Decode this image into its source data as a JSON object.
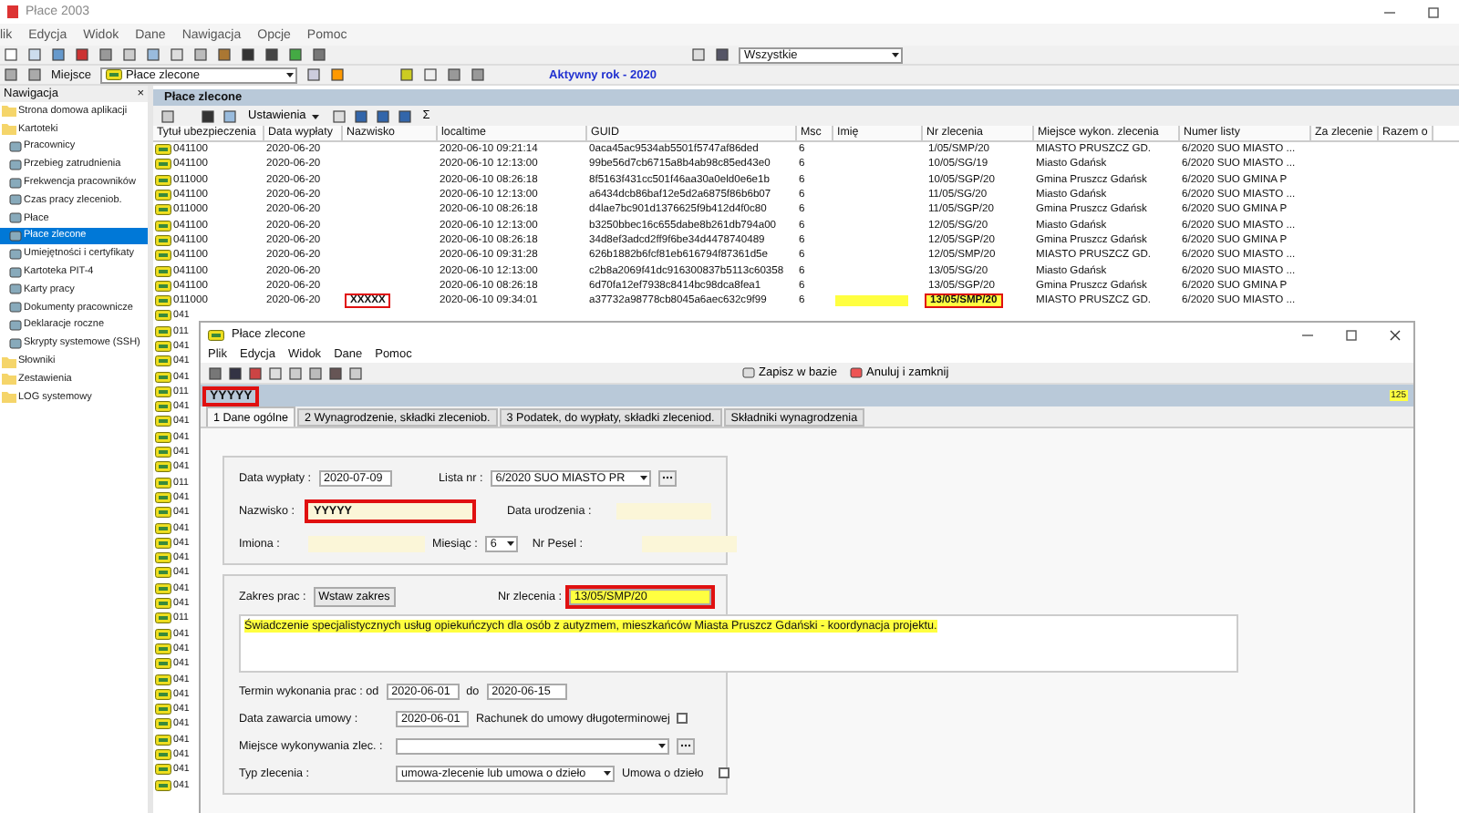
{
  "window": {
    "title": "Płace 2003"
  },
  "menu": [
    "lik",
    "Edycja",
    "Widok",
    "Dane",
    "Nawigacja",
    "Opcje",
    "Pomoc"
  ],
  "toolbar": {
    "filter": "Wszystkie"
  },
  "location_bar": {
    "label": "Miejsce",
    "value": "Płace zlecone",
    "active_year": "Aktywny rok - 2020"
  },
  "navigation": {
    "title": "Nawigacja",
    "close": "×",
    "items": [
      {
        "label": "Strona domowa aplikacji",
        "selected": false
      },
      {
        "label": "Kartoteki",
        "selected": false,
        "children": [
          {
            "label": "Pracownicy",
            "selected": false
          },
          {
            "label": "Przebieg zatrudnienia",
            "selected": false
          },
          {
            "label": "Frekwencja pracowników",
            "selected": false
          },
          {
            "label": "Czas pracy zleceniob.",
            "selected": false
          },
          {
            "label": "Płace",
            "selected": false
          },
          {
            "label": "Płace zlecone",
            "selected": true
          },
          {
            "label": "Umiejętności i certyfikaty",
            "selected": false
          },
          {
            "label": "Kartoteka PIT-4",
            "selected": false
          },
          {
            "label": "Karty pracy",
            "selected": false
          },
          {
            "label": "Dokumenty pracownicze",
            "selected": false
          },
          {
            "label": "Deklaracje roczne",
            "selected": false
          },
          {
            "label": "Skrypty systemowe (SSH)",
            "selected": false
          }
        ]
      },
      {
        "label": "Słowniki",
        "selected": false
      },
      {
        "label": "Zestawienia",
        "selected": false
      },
      {
        "label": "LOG systemowy",
        "selected": false
      }
    ]
  },
  "list": {
    "title": "Płace zlecone",
    "settings": "Ustawienia",
    "sum": "Σ",
    "columns": [
      "Tytuł ubezpieczenia",
      "Data wypłaty",
      "Nazwisko",
      "localtime",
      "GUID",
      "Msc",
      "Imię",
      "Nr zlecenia",
      "Miejsce wykon. zlecenia",
      "Numer listy",
      "Za zlecenie",
      "Razem o"
    ],
    "rows": [
      {
        "tytul": "041100",
        "data": "2020-06-20",
        "localtime": "2020-06-10 09:21:14",
        "guid": "0aca45ac9534ab5501f5747af86ded",
        "msc": "6",
        "nr": "1/05/SMP/20",
        "miejsce": "MIASTO PRUSZCZ GD.",
        "lista": "6/2020 SUO MIASTO ...",
        "annotated": false
      },
      {
        "tytul": "041100",
        "data": "2020-06-20",
        "localtime": "2020-06-10 12:13:00",
        "guid": "99be56d7cb6715a8b4ab98c85ed43e0",
        "msc": "6",
        "nr": "10/05/SG/19",
        "miejsce": "Miasto Gdańsk",
        "lista": "6/2020 SUO MIASTO ...",
        "annotated": false
      },
      {
        "tytul": "011000",
        "data": "2020-06-20",
        "localtime": "2020-06-10 08:26:18",
        "guid": "8f5163f431cc501f46aa30a0eld0e6e1b",
        "msc": "6",
        "nr": "10/05/SGP/20",
        "miejsce": "Gmina Pruszcz Gdańsk",
        "lista": "6/2020 SUO GMINA P",
        "annotated": false
      },
      {
        "tytul": "041100",
        "data": "2020-06-20",
        "localtime": "2020-06-10 12:13:00",
        "guid": "a6434dcb86baf12e5d2a6875f86b6b07",
        "msc": "6",
        "nr": "11/05/SG/20",
        "miejsce": "Miasto Gdańsk",
        "lista": "6/2020 SUO MIASTO ...",
        "annotated": false
      },
      {
        "tytul": "011000",
        "data": "2020-06-20",
        "localtime": "2020-06-10 08:26:18",
        "guid": "d4lae7bc901d1376625f9b412d4f0c80",
        "msc": "6",
        "nr": "11/05/SGP/20",
        "miejsce": "Gmina Pruszcz Gdańsk",
        "lista": "6/2020 SUO GMINA P",
        "annotated": false
      },
      {
        "tytul": "041100",
        "data": "2020-06-20",
        "localtime": "2020-06-10 12:13:00",
        "guid": "b3250bbec16c655dabe8b261db794a00",
        "msc": "6",
        "nr": "12/05/SG/20",
        "miejsce": "Miasto Gdańsk",
        "lista": "6/2020 SUO MIASTO ...",
        "annotated": false
      },
      {
        "tytul": "041100",
        "data": "2020-06-20",
        "localtime": "2020-06-10 08:26:18",
        "guid": "34d8ef3adcd2ff9f6be34d4478740489",
        "msc": "6",
        "nr": "12/05/SGP/20",
        "miejsce": "Gmina Pruszcz Gdańsk",
        "lista": "6/2020 SUO GMINA P",
        "annotated": false
      },
      {
        "tytul": "041100",
        "data": "2020-06-20",
        "localtime": "2020-06-10 09:31:28",
        "guid": "626b1882b6fcf81eb616794f87361d5e",
        "msc": "6",
        "nr": "12/05/SMP/20",
        "miejsce": "MIASTO PRUSZCZ GD.",
        "lista": "6/2020 SUO MIASTO ...",
        "annotated": false
      },
      {
        "tytul": "041100",
        "data": "2020-06-20",
        "localtime": "2020-06-10 12:13:00",
        "guid": "c2b8a2069f41dc916300837b5113c60358",
        "msc": "6",
        "nr": "13/05/SG/20",
        "miejsce": "Miasto Gdańsk",
        "lista": "6/2020 SUO MIASTO ...",
        "annotated": false
      },
      {
        "tytul": "041100",
        "data": "2020-06-20",
        "localtime": "2020-06-10 08:26:18",
        "guid": "6d70fa12ef7938c8414bc98dca8fea1",
        "msc": "6",
        "nr": "13/05/SGP/20",
        "miejsce": "Gmina Pruszcz Gdańsk",
        "lista": "6/2020 SUO GMINA P",
        "annotated": false
      },
      {
        "tytul": "011000",
        "data": "2020-06-20",
        "nazwisko": "XXXXX",
        "localtime": "2020-06-10 09:34:01",
        "guid": "a37732a98778cb8045a6aec632c9f99",
        "msc": "6",
        "nr": "13/05/SMP/20",
        "miejsce": "MIASTO PRUSZCZ GD.",
        "lista": "6/2020 SUO MIASTO ...",
        "annotated": true
      }
    ],
    "more_rows": [
      "041",
      "011",
      "041",
      "041",
      "041",
      "011",
      "041",
      "041",
      "041",
      "041",
      "041",
      "011",
      "041",
      "041",
      "041",
      "041",
      "041",
      "041",
      "041",
      "041",
      "011",
      "041",
      "041",
      "041",
      "041",
      "041",
      "041",
      "041",
      "041",
      "041",
      "041",
      "041"
    ]
  },
  "dialog": {
    "title": "Płace zlecone",
    "menu": [
      "Plik",
      "Edycja",
      "Widok",
      "Dane",
      "Pomoc"
    ],
    "save": "Zapisz w bazie",
    "cancel": "Anuluj i zamknij",
    "person": "YYYYY",
    "badge": "125",
    "tabs": [
      {
        "label": "1 Dane ogólne",
        "selected": true
      },
      {
        "label": "2 Wynagrodzenie, składki zleceniob.",
        "selected": false
      },
      {
        "label": "3 Podatek, do wypłaty, składki zleceniod.",
        "selected": false
      },
      {
        "label": "Składniki wynagrodzenia",
        "selected": false
      }
    ],
    "payment_date": {
      "label": "Data wypłaty :",
      "value": "2020-07-09"
    },
    "list_no": {
      "label": "Lista nr :",
      "value": "6/2020 SUO MIASTO PR"
    },
    "surname": {
      "label": "Nazwisko :",
      "value": "YYYYY"
    },
    "birth_date": {
      "label": "Data urodzenia :"
    },
    "first_names": {
      "label": "Imiona :"
    },
    "month": {
      "label": "Miesiąc :",
      "value": "6"
    },
    "pesel": {
      "label": "Nr Pesel :"
    },
    "scope": {
      "label": "Zakres prac :",
      "button": "Wstaw zakres"
    },
    "order_no": {
      "label": "Nr zlecenia :",
      "value": "13/05/SMP/20"
    },
    "description": "Świadczenie specjalistycznych usług opiekuńczych dla  osób z autyzmem, mieszkańców Miasta Pruszcz Gdański - koordynacja projektu.",
    "term": {
      "label": "Termin wykonania prac : od",
      "from": "2020-06-01",
      "to_label": "do",
      "to": "2020-06-15"
    },
    "contract_date": {
      "label": "Data zawarcia umowy :",
      "value": "2020-06-01"
    },
    "long_term": {
      "label": "Rachunek do umowy długoterminowej",
      "checked": false
    },
    "place": {
      "label": "Miejsce wykonywania zlec. :"
    },
    "order_type": {
      "label": "Typ zlecenia :",
      "value": "umowa-zlecenie lub umowa o dzieło"
    },
    "work_contract": {
      "label": "Umowa o dzieło",
      "checked": false
    }
  }
}
